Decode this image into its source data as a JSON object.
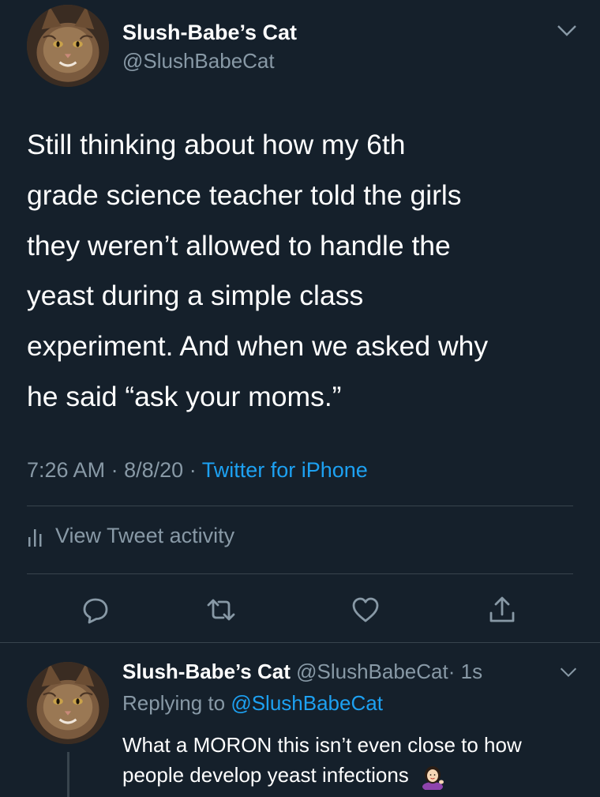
{
  "colors": {
    "background": "#15202b",
    "text_primary": "#ffffff",
    "text_secondary": "#8899a6",
    "accent": "#1da1f2",
    "divider": "#38444d"
  },
  "main_tweet": {
    "author_name": "Slush-Babe’s Cat",
    "author_handle": "@SlushBabeCat",
    "avatar": "cat-avatar",
    "menu_icon": "chevron-down-icon",
    "text": "Still thinking about how my 6th\ngrade science teacher told the girls\nthey weren’t allowed to handle the\nyeast during a simple class\nexperiment. And when we asked why\nhe said “ask your moms.”",
    "time": "7:26 AM",
    "date": "8/8/20",
    "source": "Twitter for iPhone",
    "separator": "·",
    "activity_label": "View Tweet activity",
    "actions": [
      "reply-icon",
      "retweet-icon",
      "like-icon",
      "share-icon"
    ]
  },
  "reply_tweet": {
    "author_name": "Slush-Babe’s Cat",
    "author_handle": "@SlushBabeCat",
    "separator": "·",
    "age": "1s",
    "replying_prefix": "Replying to",
    "replying_to": "@SlushBabeCat",
    "text": "What a MORON this isn’t even close to how people develop yeast infections",
    "emoji": "woman-tipping-hand-emoji",
    "menu_icon": "chevron-down-icon"
  }
}
